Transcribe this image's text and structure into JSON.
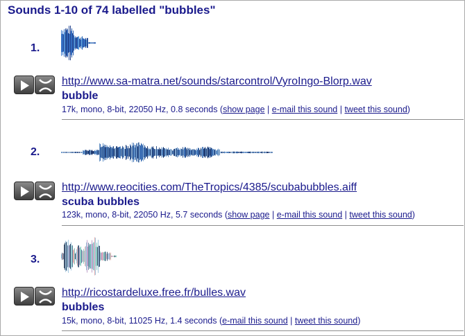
{
  "header": {
    "title": "Sounds 1-10 of 74 labelled \"bubbles\""
  },
  "colors": {
    "link": "#1a1a8c",
    "separator": "#8c8c8c"
  },
  "results": [
    {
      "number": "1.",
      "url": "http://www.sa-matra.net/sounds/starcontrol/VyroIngo-Blorp.wav",
      "title": "bubble",
      "meta_prefix": "17k, mono, 8-bit, 22050 Hz, 0.8 seconds (",
      "links": [
        "show page",
        "e-mail this sound",
        "tweet this sound"
      ],
      "meta_suffix": ")"
    },
    {
      "number": "2.",
      "url": "http://www.reocities.com/TheTropics/4385/scubabubbles.aiff",
      "title": "scuba bubbles",
      "meta_prefix": "123k, mono, 8-bit, 22050 Hz, 5.7 seconds (",
      "links": [
        "show page",
        "e-mail this sound",
        "tweet this sound"
      ],
      "meta_suffix": ")"
    },
    {
      "number": "3.",
      "url": "http://ricostardeluxe.free.fr/bulles.wav",
      "title": "bubbles",
      "meta_prefix": "15k, mono, 8-bit, 11025 Hz, 1.4 seconds (",
      "links": [
        "e-mail this sound",
        "tweet this sound"
      ],
      "meta_suffix": ")"
    }
  ],
  "icons": {
    "play": "play-icon",
    "loop": "loop-icon"
  }
}
